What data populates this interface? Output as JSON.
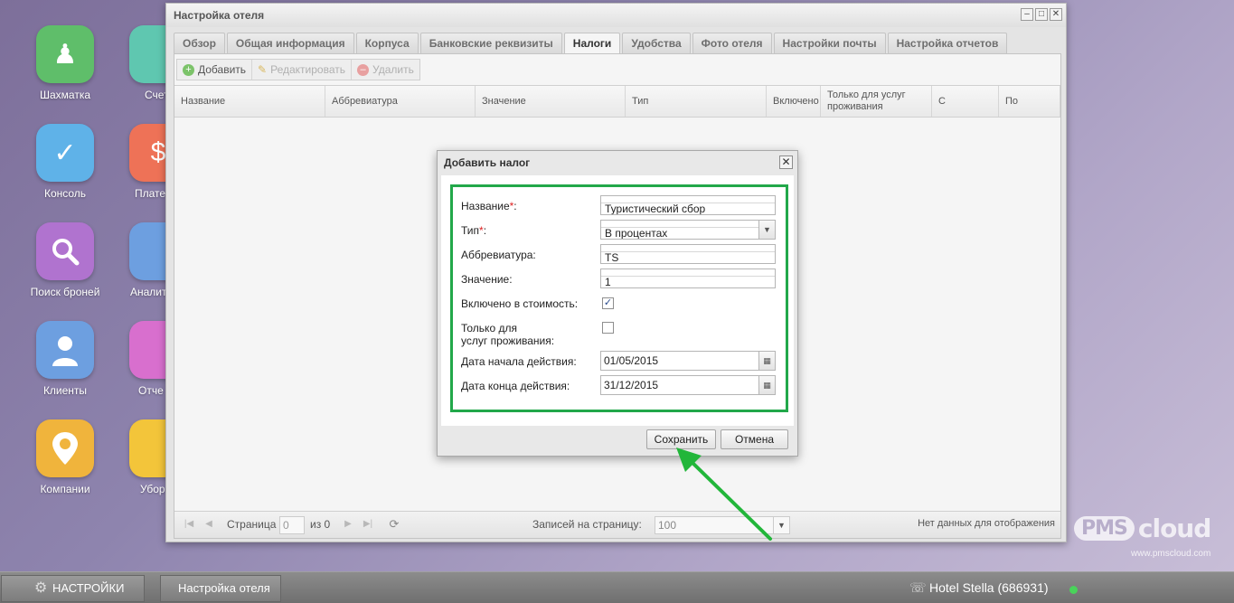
{
  "desktop": {
    "icons": [
      {
        "label": "Шахматка",
        "icon": "pawn-icon",
        "color": "#5fbe6a"
      },
      {
        "label": "Консоль",
        "icon": "check-icon",
        "color": "#5fb2e8"
      },
      {
        "label": "Поиск броней",
        "icon": "magnifier-icon",
        "color": "#b073cf"
      },
      {
        "label": "Клиенты",
        "icon": "person-icon",
        "color": "#6d9fe0"
      },
      {
        "label": "Компании",
        "icon": "map-pin-icon",
        "color": "#f0b43c"
      }
    ],
    "icons_partial": [
      {
        "label": "Счет",
        "color": "#5fc7b0"
      },
      {
        "label": "Плате",
        "color": "#ee7257"
      },
      {
        "label": "Аналит",
        "color": "#6d9fe0"
      },
      {
        "label": "Отче",
        "color": "#d86fce"
      },
      {
        "label": "Убор",
        "color": "#f3c53a"
      }
    ]
  },
  "window": {
    "title": "Настройка отеля",
    "tabs": [
      "Обзор",
      "Общая информация",
      "Корпуса",
      "Банковские реквизиты",
      "Налоги",
      "Удобства",
      "Фото отеля",
      "Настройки почты",
      "Настройка отчетов"
    ],
    "active_tab": "Налоги",
    "toolbar": {
      "add": "Добавить",
      "edit": "Редактировать",
      "delete": "Удалить"
    },
    "columns": [
      "Название",
      "Аббревиатура",
      "Значение",
      "Тип",
      "Включено в",
      "Только для услуг проживания",
      "С",
      "По"
    ],
    "pager": {
      "page_label": "Страница",
      "page_value": "0",
      "of_label": "из 0",
      "per_page_label": "Записей на страницу:",
      "per_page_value": "100",
      "empty_text": "Нет данных для отображения"
    }
  },
  "dialog": {
    "title": "Добавить налог",
    "fields": {
      "name_label": "Название",
      "name_value": "Туристический сбор",
      "type_label": "Тип",
      "type_value": "В процентах",
      "abbr_label": "Аббревиатура:",
      "abbr_value": "TS",
      "value_label": "Значение:",
      "value_value": "1",
      "included_label": "Включено в стоимость:",
      "included_checked": true,
      "only_label_1": "Только для",
      "only_label_2": "услуг проживания:",
      "only_checked": false,
      "start_label": "Дата начала действия:",
      "start_value": "01/05/2015",
      "end_label": "Дата конца действия:",
      "end_value": "31/12/2015"
    },
    "save": "Сохранить",
    "cancel": "Отмена"
  },
  "taskbar": {
    "settings": "НАСТРОЙКИ",
    "window_button": "Настройка отеля",
    "hotel": "Hotel Stella (686931)",
    "status_color": "#49d35a"
  },
  "brand": {
    "logo": "PMScloud",
    "url": "www.pmscloud.com"
  },
  "accent": {
    "highlight": "#22a84a"
  }
}
